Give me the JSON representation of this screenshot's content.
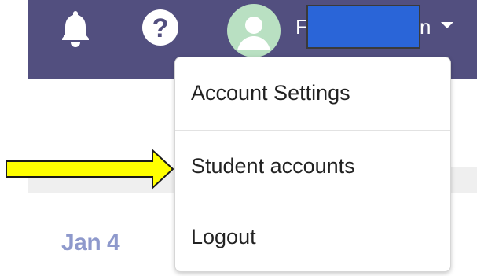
{
  "topbar": {
    "background": "#524f7f",
    "icons": [
      "bell-icon",
      "question-circle-icon",
      "user-avatar-icon",
      "caret-down-icon"
    ],
    "user_name_visible_start": "F",
    "user_name_visible_end": "n"
  },
  "dropdown": {
    "items": [
      {
        "label": "Account Settings"
      },
      {
        "label": "Student accounts"
      },
      {
        "label": "Logout"
      }
    ]
  },
  "content": {
    "date": "Jan 4",
    "date_color": "#8e99cc"
  },
  "annotations": {
    "arrow_color": "#ffff00",
    "redaction_color": "#2a65d8"
  }
}
